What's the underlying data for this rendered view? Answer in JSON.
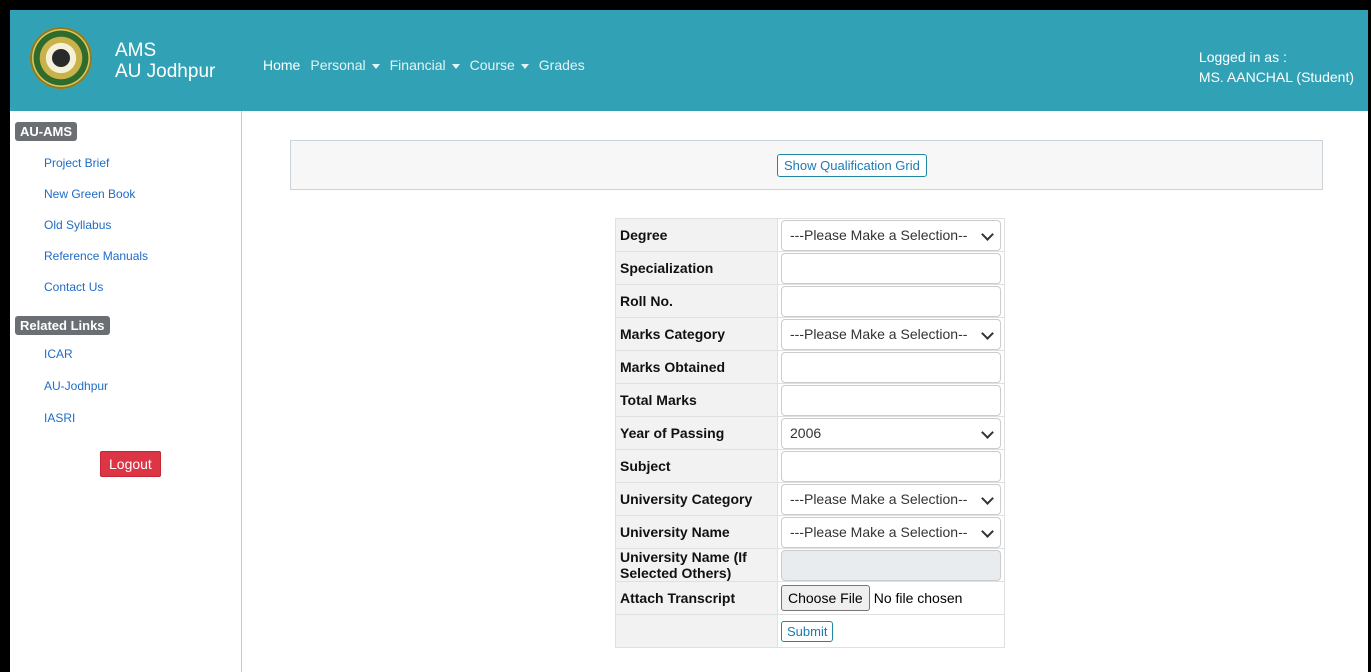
{
  "app": {
    "title": "AMS",
    "subtitle": "AU Jodhpur"
  },
  "nav": [
    {
      "label": "Home",
      "dropdown": false
    },
    {
      "label": "Personal",
      "dropdown": true
    },
    {
      "label": "Financial",
      "dropdown": true
    },
    {
      "label": "Course",
      "dropdown": true
    },
    {
      "label": "Grades",
      "dropdown": false
    }
  ],
  "user": {
    "logged_label": "Logged in as :",
    "name": "MS. AANCHAL (Student)"
  },
  "sidebar": {
    "section1": "AU-AMS",
    "links1": [
      "Project Brief",
      "New Green Book",
      "Old Syllabus",
      "Reference Manuals",
      "Contact Us"
    ],
    "section2": "Related Links",
    "links2": [
      "ICAR",
      "AU-Jodhpur",
      "IASRI"
    ],
    "logout": "Logout"
  },
  "main": {
    "show_grid_button": "Show Qualification Grid"
  },
  "form": {
    "rows": [
      {
        "label": "Degree",
        "type": "select",
        "value": "---Please Make a Selection--"
      },
      {
        "label": "Specialization",
        "type": "text",
        "value": ""
      },
      {
        "label": "Roll No.",
        "type": "text",
        "value": ""
      },
      {
        "label": "Marks Category",
        "type": "select",
        "value": "---Please Make a Selection--"
      },
      {
        "label": "Marks Obtained",
        "type": "text",
        "value": ""
      },
      {
        "label": "Total Marks",
        "type": "text",
        "value": ""
      },
      {
        "label": "Year of Passing",
        "type": "select",
        "value": "2006"
      },
      {
        "label": "Subject",
        "type": "text",
        "value": ""
      },
      {
        "label": "University Category",
        "type": "select",
        "value": "---Please Make a Selection--"
      },
      {
        "label": "University Name",
        "type": "select",
        "value": "---Please Make a Selection--"
      },
      {
        "label": "University Name (If Selected Others)",
        "type": "disabled",
        "value": ""
      },
      {
        "label": "Attach Transcript",
        "type": "file",
        "value": "No file chosen",
        "button": "Choose File"
      }
    ],
    "submit": "Submit"
  },
  "colors": {
    "topbar": "#31a2b5",
    "logout": "#dc3545",
    "link": "#1f6cc5"
  }
}
